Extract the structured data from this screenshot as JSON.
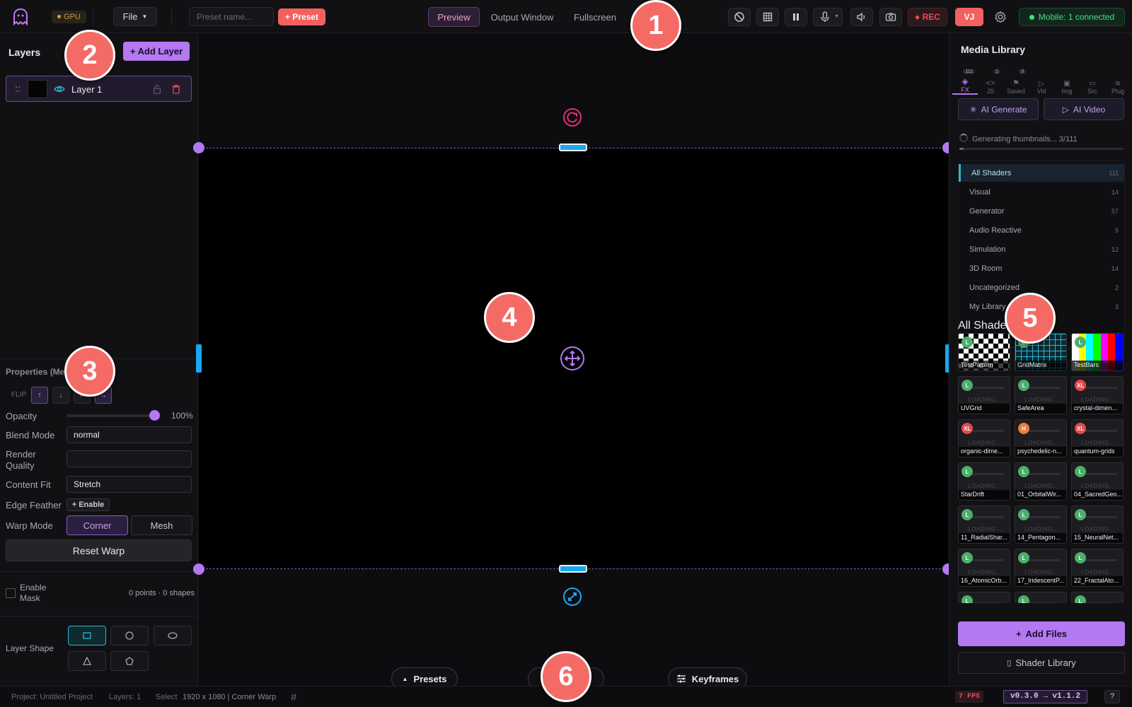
{
  "topbar": {
    "gpu_label": "GPU",
    "file_label": "File",
    "preset_placeholder": "Preset name...",
    "add_preset_label": "+ Preset",
    "view_modes": [
      "Preview",
      "Output Window",
      "Fullscreen"
    ],
    "active_view": "Preview",
    "rec_label": "● REC",
    "vj_label": "VJ",
    "mobile_status": "Mobile: 1 connected"
  },
  "layers_panel": {
    "title": "Layers",
    "add_layer_label": "+ Add Layer",
    "layers": [
      {
        "name": "Layer 1"
      }
    ]
  },
  "properties": {
    "title": "Properties (Me",
    "flip_label": "FLIP",
    "opacity_label": "Opacity",
    "opacity_value": "100%",
    "opacity_fraction": 1.0,
    "blend_mode_label": "Blend Mode",
    "blend_mode_value": "normal",
    "render_quality_label": "Render Quality",
    "render_quality_value": "",
    "content_fit_label": "Content Fit",
    "content_fit_value": "Stretch",
    "edge_feather_label": "Edge Feather",
    "edge_feather_button": "+ Enable",
    "warp_mode_label": "Warp Mode",
    "warp_modes": [
      "Corner",
      "Mesh"
    ],
    "active_warp_mode": "Corner",
    "reset_warp_label": "Reset Warp",
    "enable_mask_label": "Enable Mask",
    "mask_info": "0 points · 0 shapes",
    "layer_shape_label": "Layer Shape"
  },
  "bottom_controls": {
    "presets_label": "Presets",
    "keyframes_label": "Keyframes"
  },
  "media_library": {
    "title": "Media Library",
    "tabs": [
      {
        "label": "FX",
        "count": "111"
      },
      {
        "label": "JS",
        "count": "1"
      },
      {
        "label": "Saved",
        "count": "3"
      },
      {
        "label": "Vid",
        "count": ""
      },
      {
        "label": "Img",
        "count": ""
      },
      {
        "label": "Src",
        "count": ""
      },
      {
        "label": "Plug",
        "count": ""
      }
    ],
    "ai_generate_label": "AI Generate",
    "ai_video_label": "AI Video",
    "generating_text": "Generating thumbnails... 3/111",
    "generating_progress": 0.027,
    "categories": [
      {
        "name": "All Shaders",
        "count": "111"
      },
      {
        "name": "Visual",
        "count": "14"
      },
      {
        "name": "Generator",
        "count": "57"
      },
      {
        "name": "Audio Reactive",
        "count": "9"
      },
      {
        "name": "Simulation",
        "count": "12"
      },
      {
        "name": "3D Room",
        "count": "14"
      },
      {
        "name": "Uncategorized",
        "count": "2"
      },
      {
        "name": "My Library",
        "count": "3"
      }
    ],
    "section_title": "All Shaders",
    "loading_text": "LOADING...",
    "shaders": [
      {
        "name": "TestPattern",
        "tag": "L",
        "thumb": "checker"
      },
      {
        "name": "GridMatrix",
        "tag": "L",
        "thumb": "grid"
      },
      {
        "name": "TestBars",
        "tag": "L",
        "thumb": "bars"
      },
      {
        "name": "UVGrid",
        "tag": "L"
      },
      {
        "name": "SafeArea",
        "tag": "L"
      },
      {
        "name": "crystal-dimen...",
        "tag": "XL"
      },
      {
        "name": "organic-dime...",
        "tag": "XL"
      },
      {
        "name": "psychedelic-n...",
        "tag": "H"
      },
      {
        "name": "quantum-grids",
        "tag": "XL"
      },
      {
        "name": "StarDrift",
        "tag": "L"
      },
      {
        "name": "01_OrbitalWir...",
        "tag": "L"
      },
      {
        "name": "04_SacredGeo...",
        "tag": "L"
      },
      {
        "name": "11_RadialShar...",
        "tag": "L"
      },
      {
        "name": "14_Pentagon...",
        "tag": "L"
      },
      {
        "name": "15_NeuralNet...",
        "tag": "L"
      },
      {
        "name": "16_AtomicOrb...",
        "tag": "L"
      },
      {
        "name": "17_IridescentP...",
        "tag": "L"
      },
      {
        "name": "22_FractalAto...",
        "tag": "L"
      },
      {
        "name": "",
        "tag": "L"
      },
      {
        "name": "",
        "tag": "L"
      },
      {
        "name": "",
        "tag": "L"
      }
    ],
    "tag_colors": {
      "L": "#4caf6a",
      "XL": "#e5484d",
      "H": "#f07a3a"
    },
    "add_files_label": "Add Files",
    "shader_library_label": "Shader Library"
  },
  "statusbar": {
    "project": "Project: Untitled Project",
    "layers": "Layers: 1",
    "selected": "Select",
    "resolution": "1920 x 1080 | Corner Warp",
    "fps": "7 FPS",
    "version": "v0.3.0 → v1.1.2",
    "help": "?"
  },
  "callouts": [
    "1",
    "2",
    "3",
    "4",
    "5",
    "6"
  ],
  "colors": {
    "accent": "#b478f2",
    "rec": "#ee4a55",
    "connected": "#4ade80",
    "callout": "#f46b66"
  }
}
